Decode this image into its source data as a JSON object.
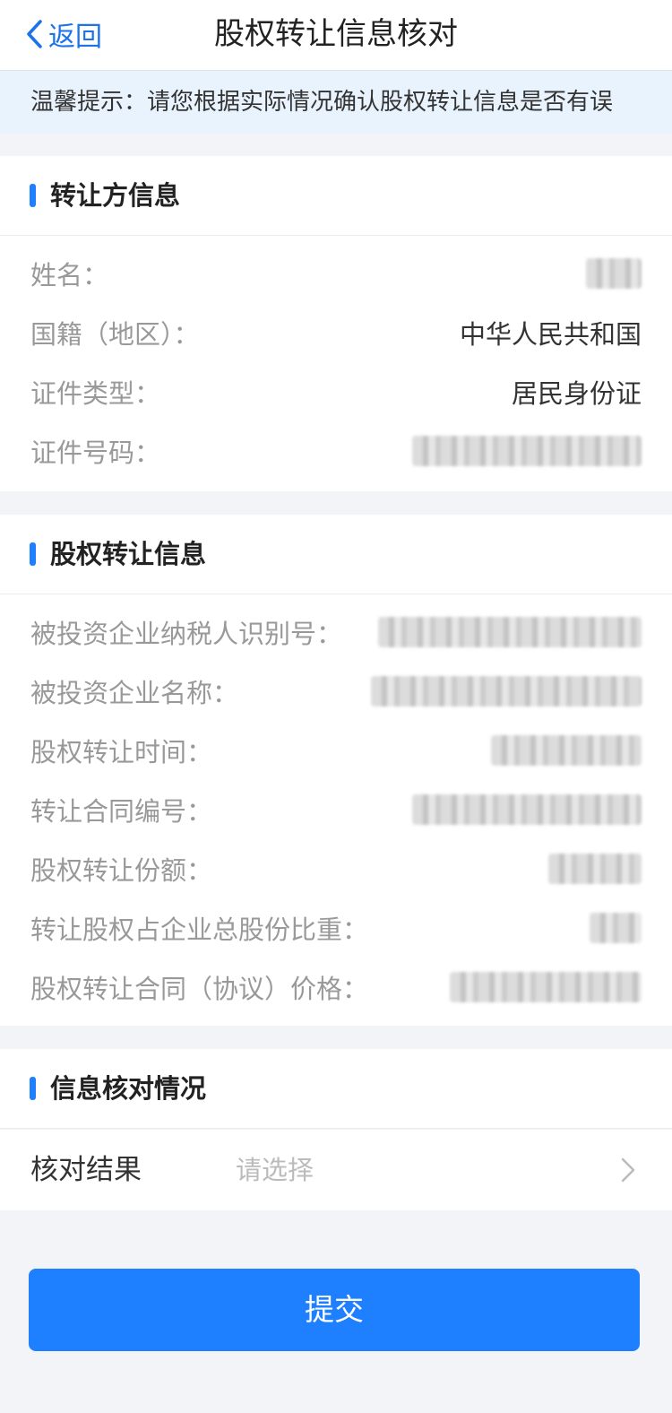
{
  "nav": {
    "back_label": "返回",
    "title": "股权转让信息核对"
  },
  "tip": "温馨提示：请您根据实际情况确认股权转让信息是否有误",
  "transferor": {
    "title": "转让方信息",
    "rows": [
      {
        "label": "姓名：",
        "value": ""
      },
      {
        "label": "国籍（地区）：",
        "value": "中华人民共和国"
      },
      {
        "label": "证件类型：",
        "value": "居民身份证"
      },
      {
        "label": "证件号码：",
        "value": ""
      }
    ]
  },
  "equity": {
    "title": "股权转让信息",
    "rows": [
      {
        "label": "被投资企业纳税人识别号：",
        "value": ""
      },
      {
        "label": "被投资企业名称：",
        "value": ""
      },
      {
        "label": "股权转让时间：",
        "value": ""
      },
      {
        "label": "转让合同编号：",
        "value": ""
      },
      {
        "label": "股权转让份额：",
        "value": ""
      },
      {
        "label": "转让股权占企业总股份比重：",
        "value": ""
      },
      {
        "label": "股权转让合同（协议）价格：",
        "value": ""
      }
    ]
  },
  "check": {
    "title": "信息核对情况",
    "result_label": "核对结果",
    "result_placeholder": "请选择"
  },
  "submit_label": "提交",
  "colors": {
    "accent": "#1e80ff",
    "tip_bg": "#e8f3fd",
    "page_bg": "#f2f4f8"
  }
}
